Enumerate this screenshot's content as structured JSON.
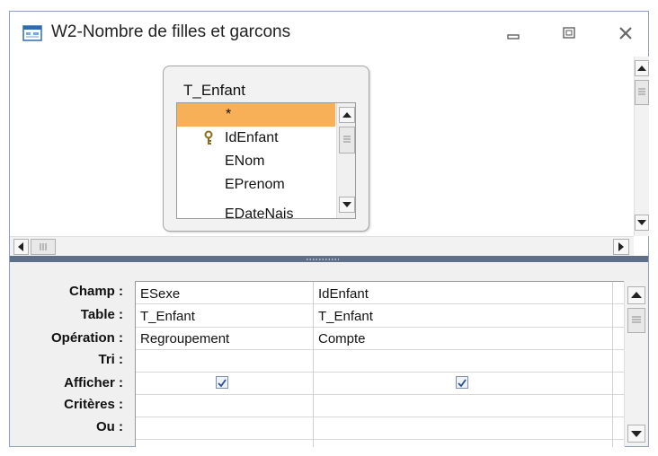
{
  "window": {
    "title": "W2-Nombre de filles et garcons",
    "controls": [
      "minimize-icon",
      "restore-icon",
      "close-icon"
    ]
  },
  "table_box": {
    "title": "T_Enfant",
    "fields": [
      "*",
      "IdEnfant",
      "ENom",
      "EPrenom",
      "EDateNais"
    ],
    "selected_field": "*",
    "primary_key_field": "IdEnfant"
  },
  "grid": {
    "row_labels": [
      "Champ :",
      "Table :",
      "Opération :",
      "Tri :",
      "Afficher :",
      "Critères :",
      "Ou :"
    ],
    "columns": [
      {
        "champ": "ESexe",
        "table": "T_Enfant",
        "operation": "Regroupement",
        "tri": "",
        "afficher": true,
        "criteres": "",
        "ou": ""
      },
      {
        "champ": "IdEnfant",
        "table": "T_Enfant",
        "operation": "Compte",
        "tri": "",
        "afficher": true,
        "criteres": "",
        "ou": ""
      }
    ]
  },
  "colors": {
    "selection": "#f8b058",
    "splitter": "#5f6f8a",
    "border": "#8ea2bd"
  }
}
